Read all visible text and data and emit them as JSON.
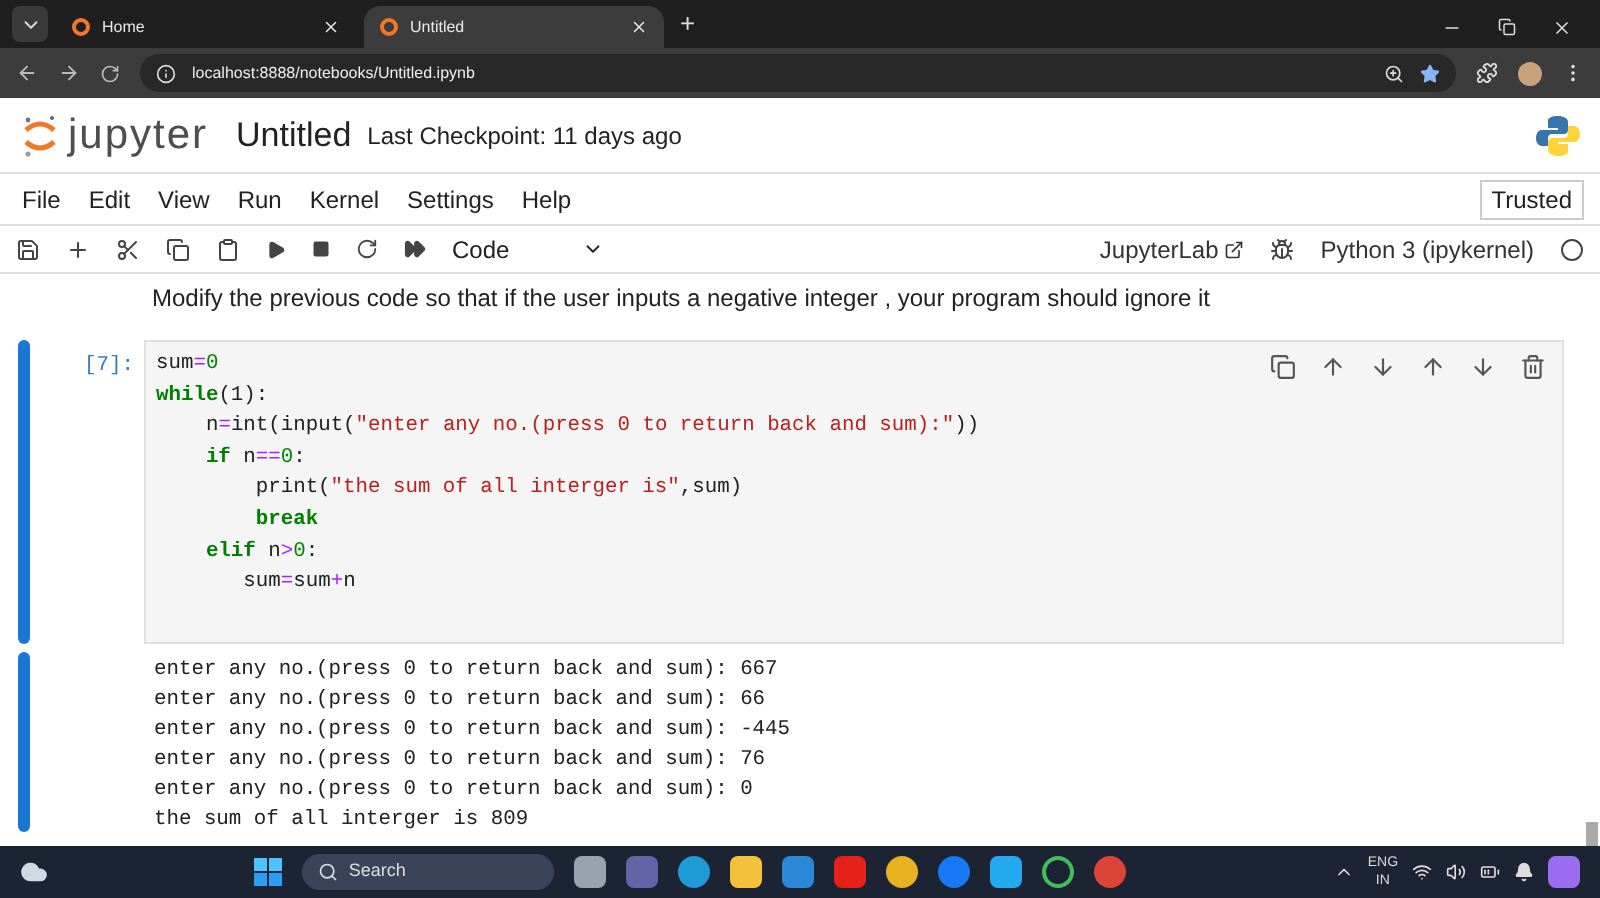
{
  "browser": {
    "tabs": [
      {
        "title": "Home",
        "selected": false
      },
      {
        "title": "Untitled",
        "selected": true
      }
    ],
    "new_tab": "+",
    "url": "localhost:8888/notebooks/Untitled.ipynb"
  },
  "header": {
    "logo": "jupyter",
    "title": "Untitled",
    "checkpoint": "Last Checkpoint: 11 days ago"
  },
  "menu": [
    "File",
    "Edit",
    "View",
    "Run",
    "Kernel",
    "Settings",
    "Help"
  ],
  "trusted": "Trusted",
  "toolbar": {
    "cell_type": "Code",
    "jupyterlab": "JupyterLab",
    "kernel": "Python 3 (ipykernel)"
  },
  "markdown": "Modify the previous code so that if the user inputs a negative integer , your program should ignore it",
  "cell": {
    "prompt": "[7]:",
    "selected": true,
    "lines": [
      [
        {
          "t": "sum",
          "kind": "name"
        },
        {
          "t": "=",
          "kind": "op"
        },
        {
          "t": "0",
          "kind": "num"
        }
      ],
      [
        {
          "t": "while",
          "kind": "kw"
        },
        {
          "t": "(1):",
          "kind": "name"
        }
      ],
      [
        {
          "t": "    n",
          "kind": "name"
        },
        {
          "t": "=",
          "kind": "op"
        },
        {
          "t": "int(input(",
          "kind": "name"
        },
        {
          "t": "\"enter any no.(press 0 to return back and sum):\"",
          "kind": "str"
        },
        {
          "t": "))",
          "kind": "name"
        }
      ],
      [
        {
          "t": "    if",
          "kind": "kw"
        },
        {
          "t": " n",
          "kind": "name"
        },
        {
          "t": "==",
          "kind": "op"
        },
        {
          "t": "0",
          "kind": "num"
        },
        {
          "t": ":",
          "kind": "name"
        }
      ],
      [
        {
          "t": "        print(",
          "kind": "name"
        },
        {
          "t": "\"the sum of all interger is\"",
          "kind": "str"
        },
        {
          "t": ",sum)",
          "kind": "name"
        }
      ],
      [
        {
          "t": "        break",
          "kind": "kw"
        }
      ],
      [
        {
          "t": "    elif",
          "kind": "kw"
        },
        {
          "t": " n",
          "kind": "name"
        },
        {
          "t": ">",
          "kind": "op"
        },
        {
          "t": "0",
          "kind": "num"
        },
        {
          "t": ":",
          "kind": "name"
        }
      ],
      [
        {
          "t": "       sum",
          "kind": "name"
        },
        {
          "t": "=",
          "kind": "op"
        },
        {
          "t": "sum",
          "kind": "name"
        },
        {
          "t": "+",
          "kind": "op"
        },
        {
          "t": "n",
          "kind": "name"
        }
      ]
    ]
  },
  "output": [
    "enter any no.(press 0 to return back and sum): 667",
    "enter any no.(press 0 to return back and sum): 66",
    "enter any no.(press 0 to return back and sum): -445",
    "enter any no.(press 0 to return back and sum): 76",
    "enter any no.(press 0 to return back and sum): 0",
    "the sum of all interger is 809"
  ],
  "taskbar": {
    "search": "Search",
    "lang": "ENG",
    "region": "IN"
  }
}
